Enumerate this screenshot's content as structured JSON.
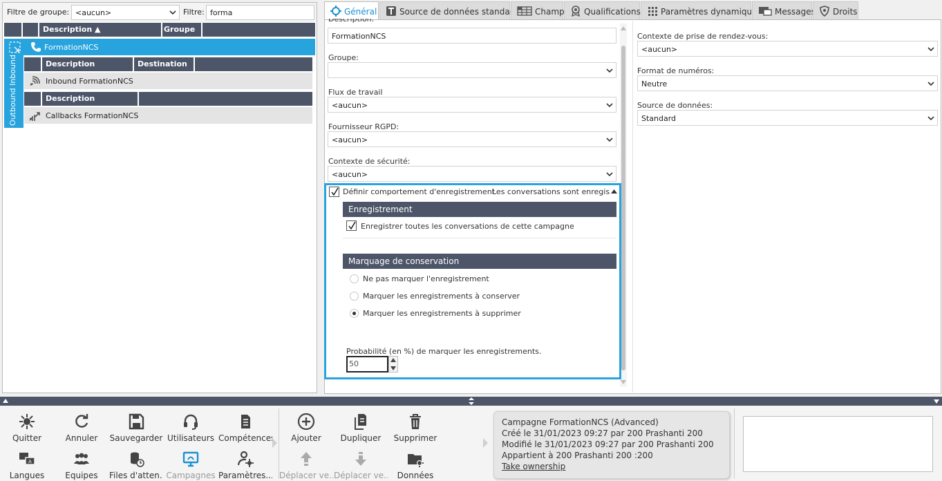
{
  "left": {
    "group_filter_label": "Filtre de groupe:",
    "group_filter_value": "<aucun>",
    "filter_label": "Filtre:",
    "filter_value": "forma",
    "headers": {
      "description": "Description ▲",
      "group": "Groupe"
    },
    "campaign": {
      "name": "FormationNCS"
    },
    "side_label": "Outbound Inbound",
    "inbound_headers": {
      "description": "Description",
      "destination": "Destination"
    },
    "inbound_item": "Inbound FormationNCS",
    "outbound_headers": {
      "description": "Description"
    },
    "outbound_item": "Callbacks FormationNCS"
  },
  "tabs": [
    {
      "label": "Général",
      "icon": "gear-icon",
      "active": true
    },
    {
      "label": "Source de données standard",
      "icon": "data-source-icon"
    },
    {
      "label": "Champs",
      "icon": "fields-icon"
    },
    {
      "label": "Qualifications",
      "icon": "badge-icon"
    },
    {
      "label": "Paramètres dynamiques",
      "icon": "grid-icon"
    },
    {
      "label": "Messages",
      "icon": "messages-icon"
    },
    {
      "label": "Droits",
      "icon": "shield-icon"
    }
  ],
  "form": {
    "description_label": "Description:",
    "description_value": "FormationNCS",
    "group_label": "Groupe:",
    "group_value": "",
    "workflow_label": "Flux de travail",
    "workflow_value": "<aucun>",
    "gdpr_label": "Fournisseur RGPD:",
    "gdpr_value": "<aucun>",
    "security_label": "Contexte de sécurité:",
    "security_value": "<aucun>",
    "recording_check_label": "Définir comportement d'enregistrement",
    "recording_summary": "Les conversations sont enregis...",
    "recording_section_title": "Enregistrement",
    "record_all_label": "Enregistrer toutes les conversations de cette campagne",
    "retention_section_title": "Marquage de conservation",
    "retention_options": [
      {
        "label": "Ne pas marquer l'enregistrement",
        "selected": false
      },
      {
        "label": "Marquer les enregistrements à conserver",
        "selected": false
      },
      {
        "label": "Marquer les enregistrements à supprimer",
        "selected": true
      }
    ],
    "probability_label": "Probabilité (en %) de marquer les enregistrements.",
    "probability_value": "50"
  },
  "right": {
    "appointment_label": "Contexte de prise de rendez-vous:",
    "appointment_value": "<aucun>",
    "number_format_label": "Format de numéros:",
    "number_format_value": "Neutre",
    "datasource_label": "Source de données:",
    "datasource_value": "Standard"
  },
  "toolbar": {
    "quit": "Quitter",
    "cancel": "Annuler",
    "save": "Sauvegarder",
    "users": "Utilisateurs",
    "skills": "Compétences",
    "languages": "Langues",
    "teams": "Equipes",
    "queues": "Files d'atten...",
    "campaigns": "Campagnes",
    "params": "Paramètres...",
    "add": "Ajouter",
    "duplicate": "Dupliquer",
    "delete": "Supprimer",
    "move_up": "Déplacer ve...",
    "move_down": "Déplacer ve...",
    "data": "Données"
  },
  "info": {
    "line1": "Campagne FormationNCS (Advanced)",
    "line2": "Créé le 31/01/2023 09:27 par 200 Prashanti 200",
    "line3": "Modifié le 31/01/2023 09:27 par 200 Prashanti 200",
    "line4": "Appartient à 200 Prashanti 200 :200",
    "link": "Take ownership"
  },
  "colors": {
    "accent": "#1a8fd0",
    "header": "#4d5668",
    "selected_row": "#27a3dd"
  }
}
